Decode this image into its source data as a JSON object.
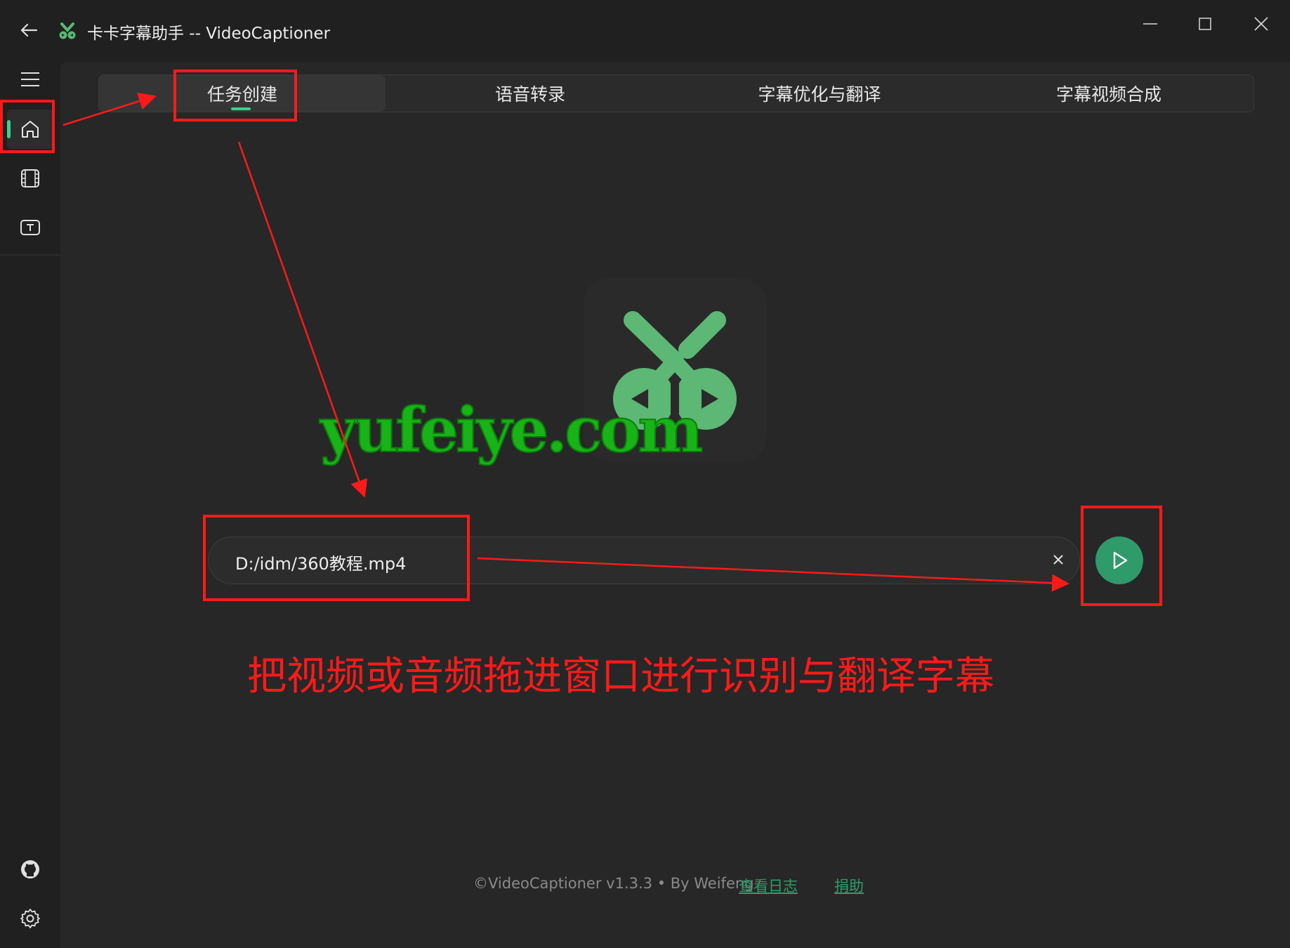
{
  "window": {
    "title": "卡卡字幕助手 -- VideoCaptioner",
    "back_icon": "arrow-left-icon",
    "logo_icon": "scissors-logo-icon"
  },
  "sidebar": {
    "items": [
      {
        "icon": "menu-icon",
        "active": false
      },
      {
        "icon": "home-icon",
        "active": true
      },
      {
        "icon": "film-icon",
        "active": false
      },
      {
        "icon": "text-box-icon",
        "active": false
      }
    ],
    "bottom_items": [
      {
        "icon": "github-icon"
      },
      {
        "icon": "gear-icon"
      }
    ]
  },
  "tabs": [
    {
      "label": "任务创建",
      "selected": true
    },
    {
      "label": "语音转录",
      "selected": false
    },
    {
      "label": "字幕优化与翻译",
      "selected": false
    },
    {
      "label": "字幕视频合成",
      "selected": false
    }
  ],
  "watermark": "yufeiye.com",
  "task": {
    "path_value": "D:/idm/360教程.mp4",
    "clear_icon": "close-icon",
    "start_icon": "play-icon"
  },
  "annotation": {
    "hint": "把视频或音频拖进窗口进行识别与翻译字幕"
  },
  "footer": {
    "copyright": "©VideoCaptioner v1.3.3 • By Weifeng",
    "log_link": "查看日志",
    "donate_link": "捐助"
  },
  "colors": {
    "accent": "#3ecf8e",
    "start_button": "#2f9a6a",
    "logo_green": "#5cb874",
    "annotation_red": "#ff1a1a",
    "watermark_green": "#17b317",
    "link": "#2e9c6a"
  }
}
